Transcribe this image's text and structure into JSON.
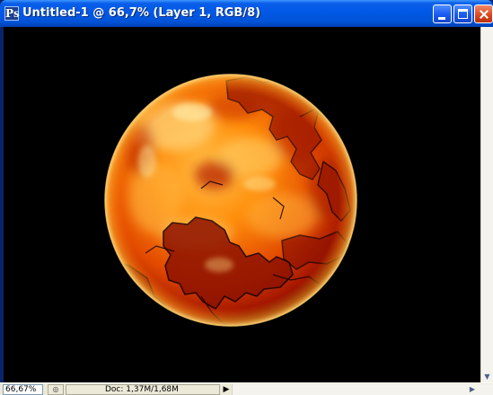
{
  "window": {
    "title": "Untitled-1 @ 66,7% (Layer 1, RGB/8)",
    "app_icon_glyph": "Ps"
  },
  "icons": {
    "app": "photoshop-document-icon",
    "minimize": "minimize-icon",
    "maximize": "maximize-icon",
    "close": "close-icon",
    "scroll_down": "scroll-down-arrow-icon",
    "status_menu": "status-menu-arrow-icon"
  },
  "status": {
    "zoom": "66,67%",
    "doc_info": "Doc: 1,37M/1,68M",
    "nav_glyph": "◎",
    "menu_arrow": "▶",
    "scroll_arrow_down": "▼",
    "scroll_arrow_right": "▶"
  },
  "colors": {
    "titlebar": "#0054e3",
    "canvas_bg": "#000000",
    "planet_core": "#ff8a00",
    "planet_dark": "#a81400",
    "planet_highlight": "#ffd77a"
  }
}
